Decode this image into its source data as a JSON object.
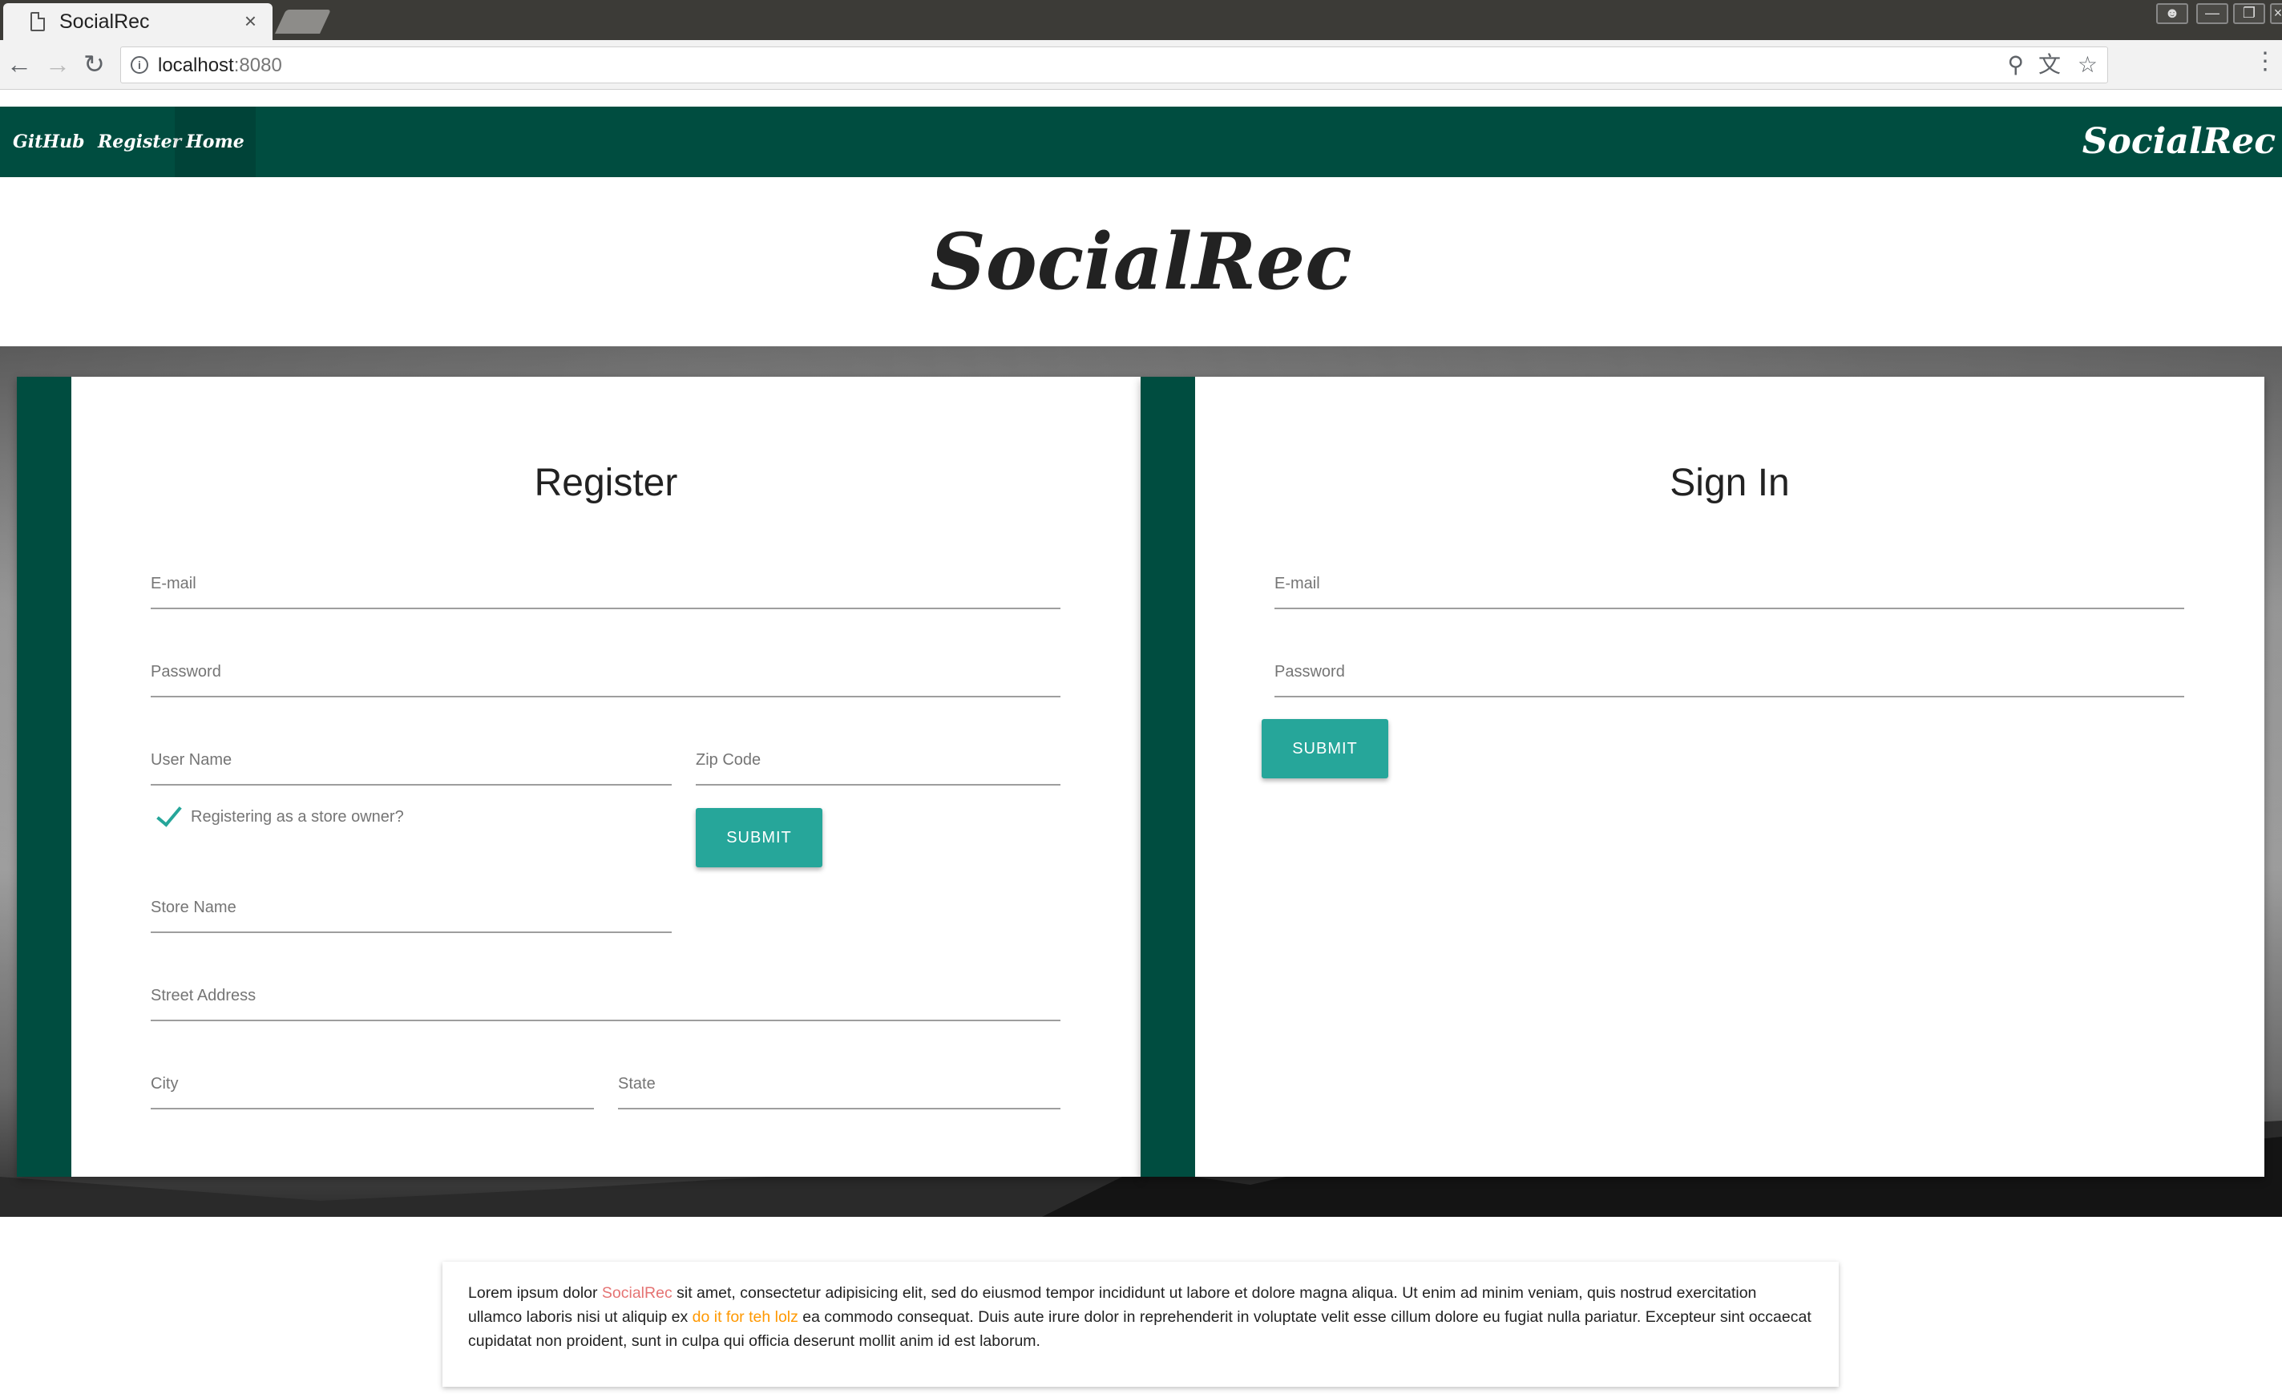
{
  "browser": {
    "tab_title": "SocialRec",
    "tab_close": "×",
    "url_host": "localhost",
    "url_port": ":8080",
    "icons": [
      "page-icon",
      "back-icon",
      "forward-icon",
      "reload-icon",
      "info-icon",
      "zoom-icon",
      "translate-icon",
      "star-icon",
      "menu-icon"
    ]
  },
  "navbar": {
    "links": [
      "GitHub",
      "Register",
      "Home"
    ],
    "brand": "SocialRec",
    "color": "#004d40"
  },
  "hero": {
    "title": "SocialRec"
  },
  "register": {
    "title": "Register",
    "email_label": "E-mail",
    "password_label": "Password",
    "username_label": "User Name",
    "zip_label": "Zip Code",
    "store_owner_label": "Registering as a store owner?",
    "store_owner_checked": true,
    "store_name_label": "Store Name",
    "street_label": "Street Address",
    "city_label": "City",
    "state_label": "State",
    "submit_label": "SUBMIT"
  },
  "signin": {
    "title": "Sign In",
    "email_label": "E-mail",
    "password_label": "Password",
    "submit_label": "SUBMIT"
  },
  "footer": {
    "text_1": "Lorem ipsum dolor ",
    "link_1": "SocialRec",
    "text_2": " sit amet, consectetur adipisicing elit, sed do eiusmod tempor incididunt ut labore et dolore magna aliqua. Ut enim ad minim veniam, quis nostrud exercitation ullamco laboris nisi ut aliquip ex ",
    "link_2": "do it for teh lolz",
    "text_3": " ea commodo consequat. Duis aute irure dolor in reprehenderit in voluptate velit esse cillum dolore eu fugiat nulla pariatur. Excepteur sint occaecat cupidatat non proident, sunt in culpa qui officia deserunt mollit anim id est laborum."
  },
  "colors": {
    "primary": "#004d40",
    "accent": "#26a69a",
    "link_red": "#e57373",
    "link_orange": "#ff9800"
  }
}
